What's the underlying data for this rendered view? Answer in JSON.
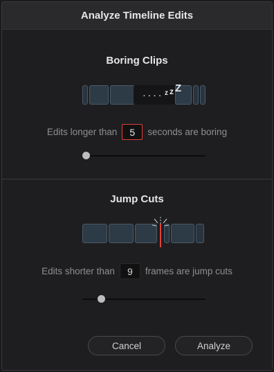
{
  "dialog": {
    "title": "Analyze Timeline Edits"
  },
  "boring": {
    "title": "Boring Clips",
    "zzz_dots": ". . . . ",
    "zzz_letters": [
      "z",
      "z",
      "Z"
    ],
    "prefix": "Edits longer than",
    "value": "5",
    "suffix": "seconds are boring",
    "slider_level": 0.0
  },
  "jump": {
    "title": "Jump Cuts",
    "prefix": "Edits shorter than",
    "value": "9",
    "suffix": "frames are jump cuts",
    "slider_level": 0.13
  },
  "buttons": {
    "cancel": "Cancel",
    "analyze": "Analyze"
  },
  "colors": {
    "accent_red": "#e0413a",
    "clip_fill": "#2d3b47",
    "background": "#1e1e20"
  },
  "icons": {
    "boring_marker": "sleep-zzz-icon",
    "jump_marker": "cut-spark-icon"
  }
}
